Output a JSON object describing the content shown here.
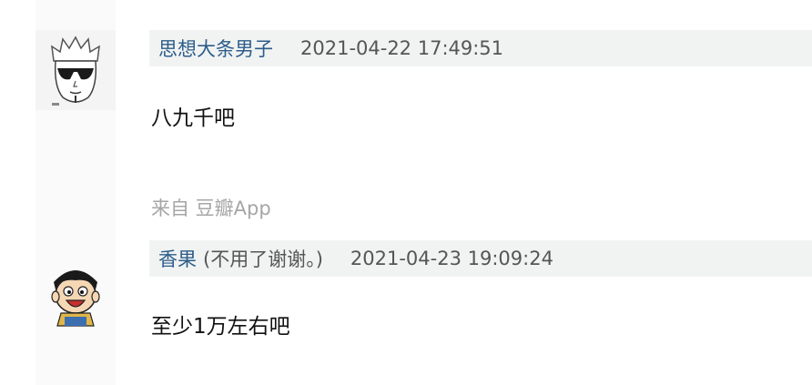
{
  "comments": [
    {
      "author": "思想大条男子",
      "author_note": "",
      "timestamp": "2021-04-22 17:49:51",
      "text": "八九千吧",
      "source": "来自 豆瓣App",
      "avatar_icon": "sunglasses-man-avatar-icon"
    },
    {
      "author": "香果",
      "author_note": "(不用了谢谢。)",
      "timestamp": "2021-04-23 19:09:24",
      "text": "至少1万左右吧",
      "avatar_icon": "cartoon-boy-avatar-icon"
    }
  ],
  "colors": {
    "author_link": "#2d5d8a",
    "meta_background": "#f1f3f3",
    "source_text": "#a6a6a6"
  }
}
